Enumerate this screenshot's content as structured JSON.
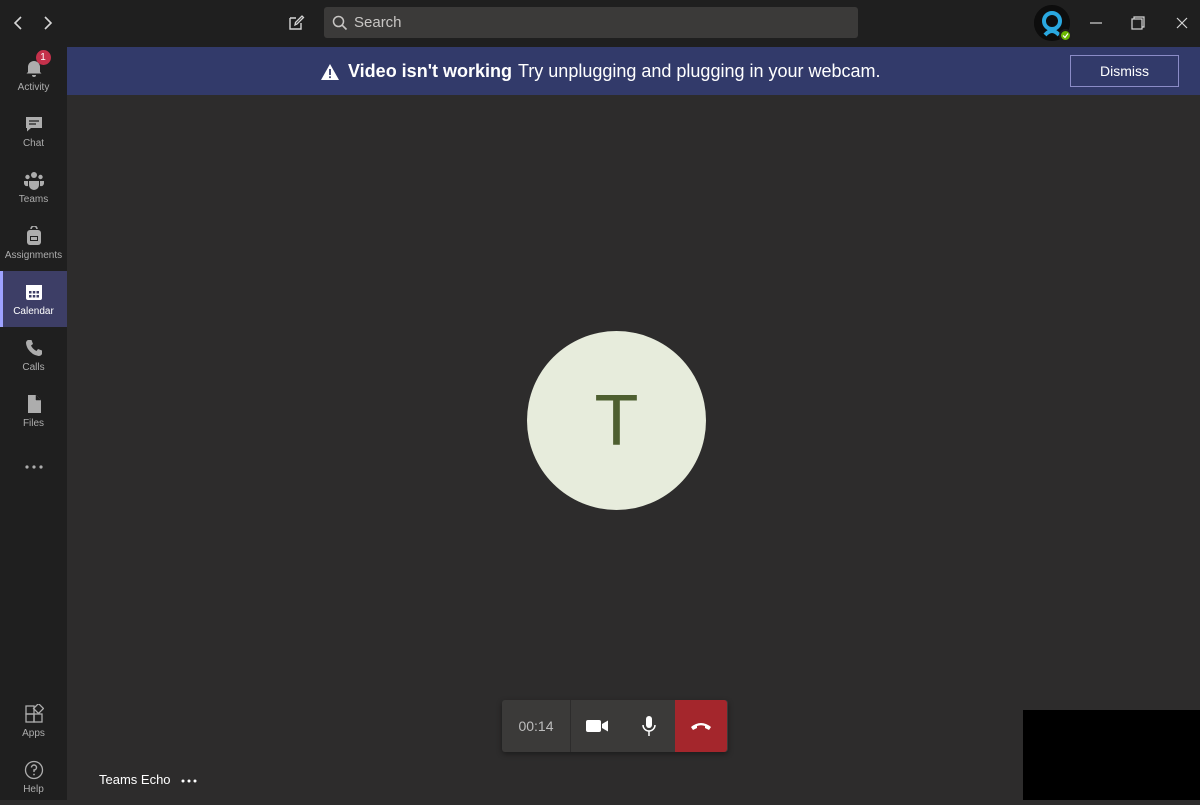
{
  "titlebar": {
    "back_icon": "chevron-left-icon",
    "forward_icon": "chevron-right-icon",
    "compose_icon": "compose-icon",
    "search_placeholder": "Search"
  },
  "rail": {
    "items": [
      {
        "label": "Activity",
        "icon": "bell-icon",
        "badge": "1"
      },
      {
        "label": "Chat",
        "icon": "chat-icon"
      },
      {
        "label": "Teams",
        "icon": "teams-icon"
      },
      {
        "label": "Assignments",
        "icon": "backpack-icon"
      },
      {
        "label": "Calendar",
        "icon": "calendar-icon",
        "active": true
      },
      {
        "label": "Calls",
        "icon": "phone-icon"
      },
      {
        "label": "Files",
        "icon": "file-icon"
      }
    ],
    "more_icon": "ellipsis-icon",
    "bottom": [
      {
        "label": "Apps",
        "icon": "apps-icon"
      },
      {
        "label": "Help",
        "icon": "help-icon"
      }
    ]
  },
  "banner": {
    "icon": "warning-icon",
    "title": "Video isn't working",
    "message": "Try unplugging and plugging in your webcam.",
    "dismiss_label": "Dismiss",
    "color": "#323a6a"
  },
  "call": {
    "caller_initial": "T",
    "timer": "00:14",
    "participant_name": "Teams Echo",
    "hangup_color": "#a4262c",
    "avatar_bg": "#e7ecdc"
  }
}
